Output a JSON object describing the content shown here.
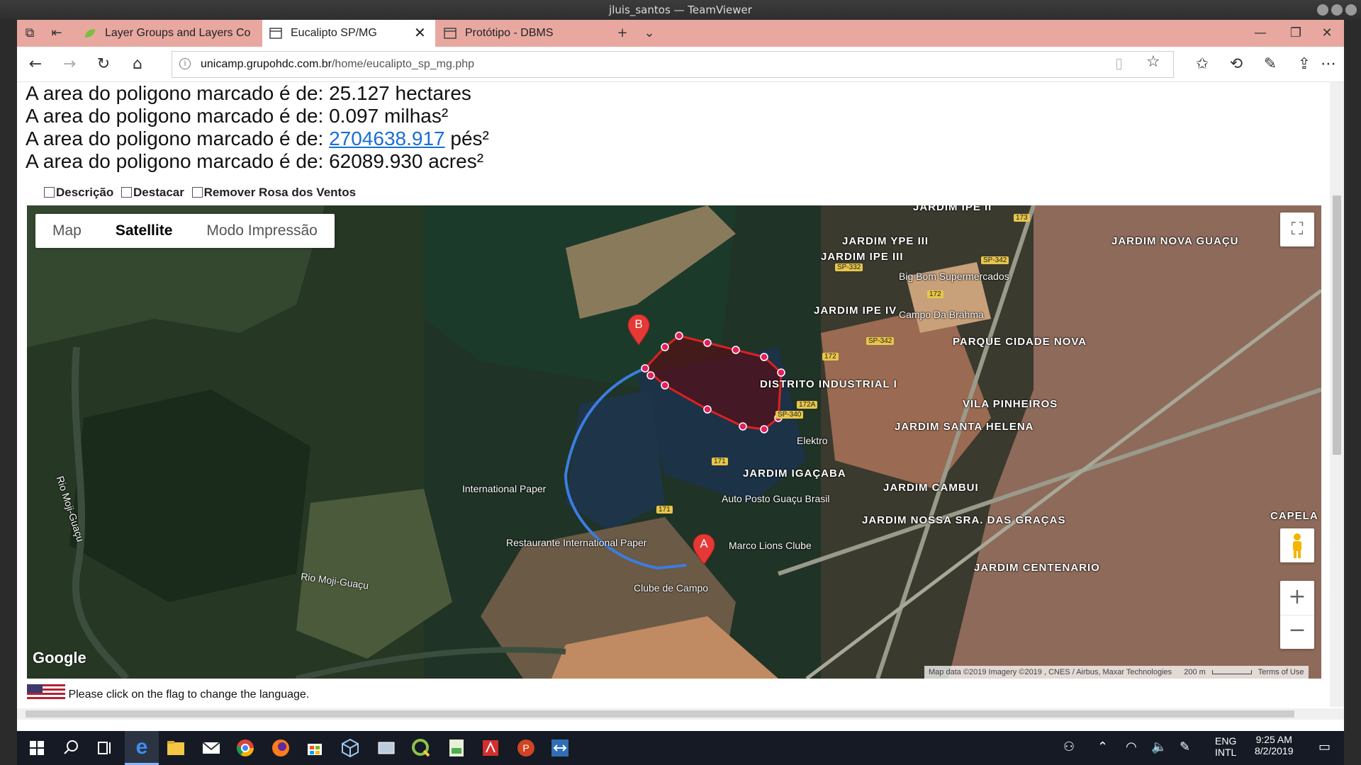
{
  "window_title": "jluis_santos — TeamViewer",
  "tabs": [
    {
      "label": "Layer Groups and Layers Co",
      "active": false
    },
    {
      "label": "Eucalipto SP/MG",
      "active": true
    },
    {
      "label": "Protótipo - DBMS",
      "active": false
    }
  ],
  "address": {
    "host": "unicamp.grupohdc.com.br",
    "path": "/home/eucalipto_sp_mg.php"
  },
  "area": {
    "prefix": "A area do poligono marcado é de:",
    "hectares": "25.127",
    "hectares_unit": "hectares",
    "milhas": "0.097",
    "milhas_unit": "milhas²",
    "pes": "2704638.917",
    "pes_unit": "pés²",
    "acres": "62089.930",
    "acres_unit": "acres²"
  },
  "options": {
    "descricao": "Descrição",
    "destacar": "Destacar",
    "remover_rosa": "Remover Rosa dos Ventos"
  },
  "map": {
    "types": [
      "Map",
      "Satellite",
      "Modo Impressão"
    ],
    "active_type": "Satellite",
    "marker_a": "A",
    "marker_b": "B",
    "google": "Google",
    "attribution": "Map data ©2019 Imagery ©2019 , CNES / Airbus, Maxar Technologies",
    "scale": "200 m",
    "terms": "Terms of Use",
    "labels": [
      "JARDIM IPE II",
      "JARDIM YPE III",
      "JARDIM IPE III",
      "JARDIM NOVA GUAÇU",
      "Big Bom Supermercados",
      "JARDIM IPE IV",
      "Campo Da Brahma",
      "PARQUE CIDADE NOVA",
      "DISTRITO INDUSTRIAL I",
      "VILA PINHEIROS",
      "JARDIM SANTA HELENA",
      "Elektro",
      "JARDIM IGAÇABA",
      "JARDIM CAMBUI",
      "Auto Posto Guaçu Brasil",
      "JARDIM NOSSA SRA. DAS GRAÇAS",
      "Marco Lions Clube",
      "JARDIM CENTENARIO",
      "International Paper",
      "Restaurante International Paper",
      "Rio Moji-Guaçu",
      "Rio Moji-Guaçu",
      "Clube de Campo",
      "CAPELA",
      "SP-332",
      "SP-342",
      "SP-342",
      "SP-340",
      "172",
      "172",
      "172A",
      "171",
      "171",
      "173"
    ],
    "colors": {
      "polygon": "#e02020",
      "route": "#3b7de0",
      "marker": "#e53935"
    }
  },
  "footer": "Please click on the flag to change the language.",
  "tray": {
    "lang1": "ENG",
    "lang2": "INTL",
    "time": "9:25 AM",
    "date": "8/2/2019"
  }
}
